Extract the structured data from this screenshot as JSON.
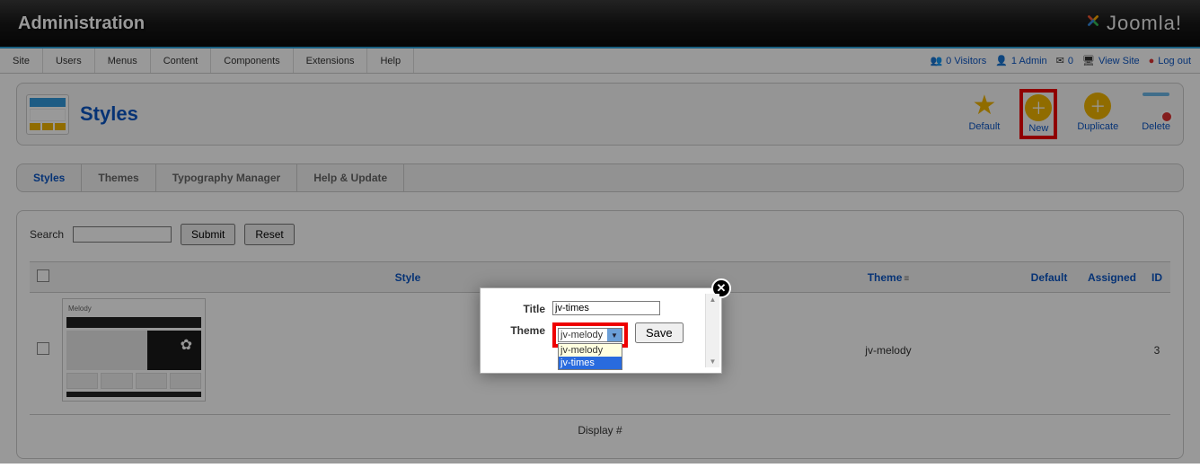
{
  "header": {
    "title": "Administration",
    "brand": "Joomla!"
  },
  "menu": {
    "items": [
      "Site",
      "Users",
      "Menus",
      "Content",
      "Components",
      "Extensions",
      "Help"
    ],
    "status": {
      "visitors": "0 Visitors",
      "admins": "1 Admin",
      "messages": "0",
      "view_site": "View Site",
      "logout": "Log out"
    }
  },
  "page": {
    "title": "Styles"
  },
  "toolbar": {
    "default": "Default",
    "new": "New",
    "duplicate": "Duplicate",
    "delete": "Delete"
  },
  "subtabs": [
    "Styles",
    "Themes",
    "Typography Manager",
    "Help & Update"
  ],
  "filter": {
    "label": "Search",
    "submit": "Submit",
    "reset": "Reset"
  },
  "grid": {
    "headers": {
      "style": "Style",
      "theme": "Theme",
      "default": "Default",
      "assigned": "Assigned",
      "id": "ID"
    },
    "rows": [
      {
        "thumb_title": "Melody",
        "theme": "jv-melody",
        "id": "3"
      }
    ]
  },
  "display_label": "Display #",
  "modal": {
    "title_label": "Title",
    "title_value": "jv-times",
    "theme_label": "Theme",
    "theme_selected": "jv-melody",
    "options": [
      "jv-melody",
      "jv-times"
    ],
    "save": "Save"
  }
}
